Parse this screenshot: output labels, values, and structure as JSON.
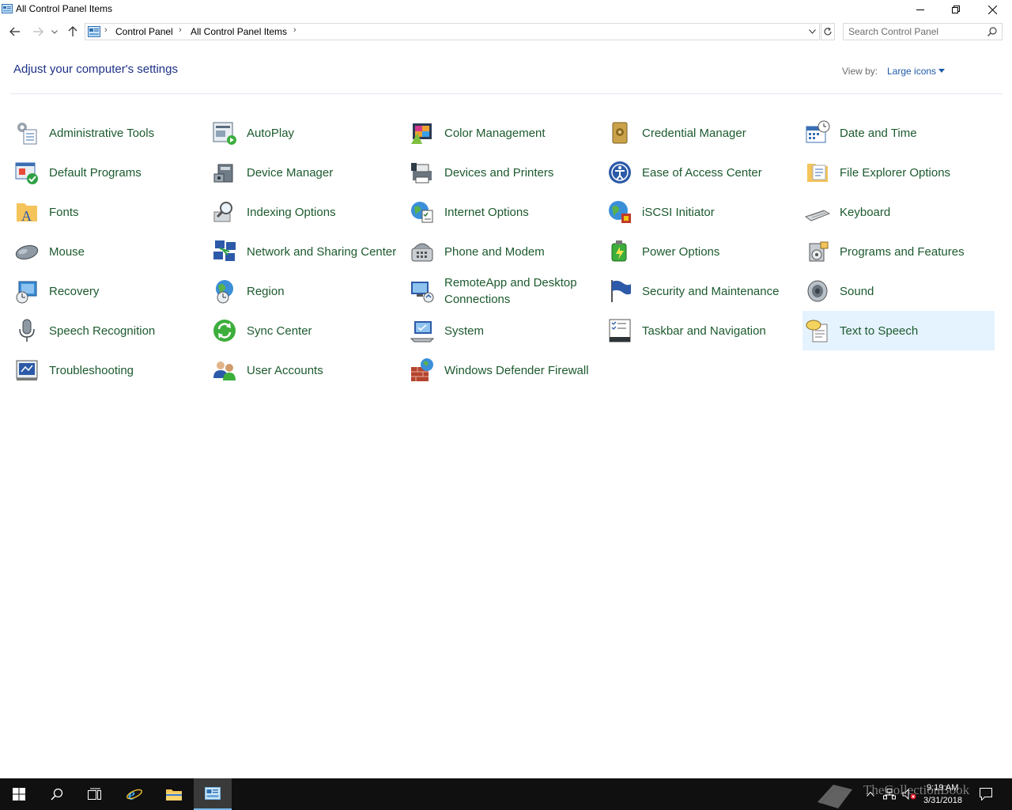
{
  "window": {
    "title": "All Control Panel Items",
    "minimize_icon": "minimize-icon",
    "restore_icon": "restore-icon",
    "close_icon": "close-icon"
  },
  "navigation": {
    "breadcrumbs": [
      "Control Panel",
      "All Control Panel Items"
    ],
    "search_placeholder": "Search Control Panel"
  },
  "header": {
    "title": "Adjust your computer's settings",
    "view_by_label": "View by:",
    "view_by_value": "Large icons"
  },
  "items": [
    {
      "label": "Administrative Tools",
      "icon": "administrative-tools-icon"
    },
    {
      "label": "AutoPlay",
      "icon": "autoplay-icon"
    },
    {
      "label": "Color Management",
      "icon": "color-management-icon"
    },
    {
      "label": "Credential Manager",
      "icon": "credential-manager-icon"
    },
    {
      "label": "Date and Time",
      "icon": "date-and-time-icon"
    },
    {
      "label": "Default Programs",
      "icon": "default-programs-icon"
    },
    {
      "label": "Device Manager",
      "icon": "device-manager-icon"
    },
    {
      "label": "Devices and Printers",
      "icon": "devices-and-printers-icon"
    },
    {
      "label": "Ease of Access Center",
      "icon": "ease-of-access-icon"
    },
    {
      "label": "File Explorer Options",
      "icon": "file-explorer-options-icon"
    },
    {
      "label": "Fonts",
      "icon": "fonts-icon"
    },
    {
      "label": "Indexing Options",
      "icon": "indexing-options-icon"
    },
    {
      "label": "Internet Options",
      "icon": "internet-options-icon"
    },
    {
      "label": "iSCSI Initiator",
      "icon": "iscsi-initiator-icon"
    },
    {
      "label": "Keyboard",
      "icon": "keyboard-icon"
    },
    {
      "label": "Mouse",
      "icon": "mouse-icon"
    },
    {
      "label": "Network and Sharing Center",
      "icon": "network-sharing-icon"
    },
    {
      "label": "Phone and Modem",
      "icon": "phone-modem-icon"
    },
    {
      "label": "Power Options",
      "icon": "power-options-icon"
    },
    {
      "label": "Programs and Features",
      "icon": "programs-features-icon"
    },
    {
      "label": "Recovery",
      "icon": "recovery-icon"
    },
    {
      "label": "Region",
      "icon": "region-icon"
    },
    {
      "label": "RemoteApp and Desktop Connections",
      "icon": "remoteapp-icon"
    },
    {
      "label": "Security and Maintenance",
      "icon": "security-maintenance-icon"
    },
    {
      "label": "Sound",
      "icon": "sound-icon"
    },
    {
      "label": "Speech Recognition",
      "icon": "speech-recognition-icon"
    },
    {
      "label": "Sync Center",
      "icon": "sync-center-icon"
    },
    {
      "label": "System",
      "icon": "system-icon"
    },
    {
      "label": "Taskbar and Navigation",
      "icon": "taskbar-navigation-icon"
    },
    {
      "label": "Text to Speech",
      "icon": "text-to-speech-icon",
      "highlighted": true
    },
    {
      "label": "Troubleshooting",
      "icon": "troubleshooting-icon"
    },
    {
      "label": "User Accounts",
      "icon": "user-accounts-icon"
    },
    {
      "label": "Windows Defender Firewall",
      "icon": "firewall-icon"
    }
  ],
  "taskbar": {
    "buttons": [
      "start-icon",
      "search-icon",
      "task-view-icon",
      "internet-explorer-icon",
      "file-explorer-icon",
      "control-panel-icon"
    ],
    "clock_time": "9:19 AM",
    "clock_date": "3/31/2018",
    "watermark": "TheCollectionBook"
  },
  "colors": {
    "link_green": "#1c5a2e",
    "heading_blue": "#1e3287",
    "hover_bg": "#e5f3ff",
    "taskbar": "#101010"
  }
}
